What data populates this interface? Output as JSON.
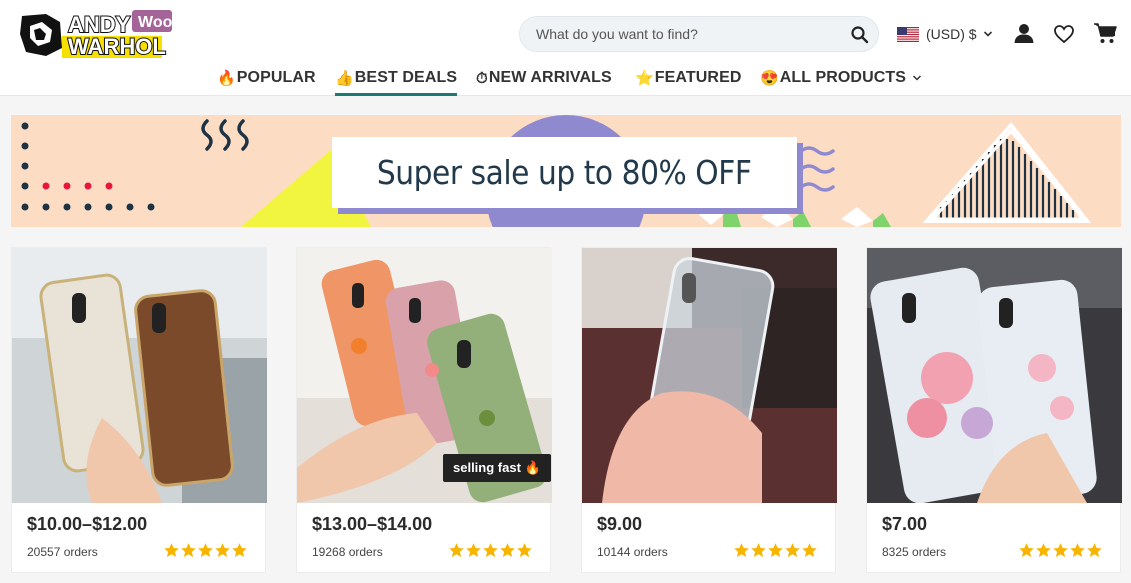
{
  "brand": {
    "line1": "ANDY",
    "line2": "WARHOL",
    "tag": "Woo"
  },
  "search": {
    "placeholder": "What do you want to find?",
    "icon": "search-icon"
  },
  "currency": {
    "label": "(USD) $",
    "flag": "us-flag-icon"
  },
  "header_icons": [
    "user-icon",
    "heart-icon",
    "cart-icon"
  ],
  "nav": {
    "items": [
      {
        "emoji": "🔥",
        "label": "POPULAR"
      },
      {
        "emoji": "👍",
        "label": "BEST DEALS",
        "active": true
      },
      {
        "emoji": "⏱",
        "label": "NEW ARRIVALS"
      },
      {
        "emoji": "⭐",
        "label": "FEATURED"
      },
      {
        "emoji": "😍",
        "label": "ALL PRODUCTS",
        "dropdown": true
      }
    ]
  },
  "banner": {
    "text": "Super sale up to 80% OFF"
  },
  "colors": {
    "accent": "#1b7a72",
    "banner_bg": "#fddcc4",
    "star": "#f7b500",
    "badge_bg": "#222222"
  },
  "products": [
    {
      "price": "$10.00–$12.00",
      "orders": "20557 orders",
      "rating": 5
    },
    {
      "price": "$13.00–$14.00",
      "orders": "19268 orders",
      "rating": 5,
      "badge": "selling fast 🔥"
    },
    {
      "price": "$9.00",
      "orders": "10144 orders",
      "rating": 5
    },
    {
      "price": "$7.00",
      "orders": "8325 orders",
      "rating": 5
    }
  ]
}
